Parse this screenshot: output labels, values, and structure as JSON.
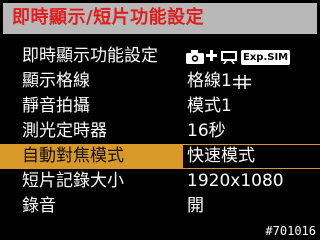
{
  "header": {
    "title": "即時顯示/短片功能設定"
  },
  "menu": {
    "items": [
      {
        "label": "即時顯示功能設定",
        "value": "",
        "exp_sim": "Exp.SIM"
      },
      {
        "label": "顯示格線",
        "value": "格線1"
      },
      {
        "label": "靜音拍攝",
        "value": "模式1"
      },
      {
        "label": "測光定時器",
        "value": "16秒"
      },
      {
        "label": "自動對焦模式",
        "value": "快速模式"
      },
      {
        "label": "短片記錄大小",
        "value": "1920x1080"
      },
      {
        "label": "錄音",
        "value": "開"
      }
    ],
    "selected_index": 4
  },
  "watermark": "#701016",
  "colors": {
    "title_bg": "#b8b8b8",
    "title_text": "#e11d1d",
    "highlight": "#d9982a"
  },
  "icons": [
    "camera-icon",
    "arrow-right-icon",
    "movie-icon",
    "grid-icon"
  ]
}
